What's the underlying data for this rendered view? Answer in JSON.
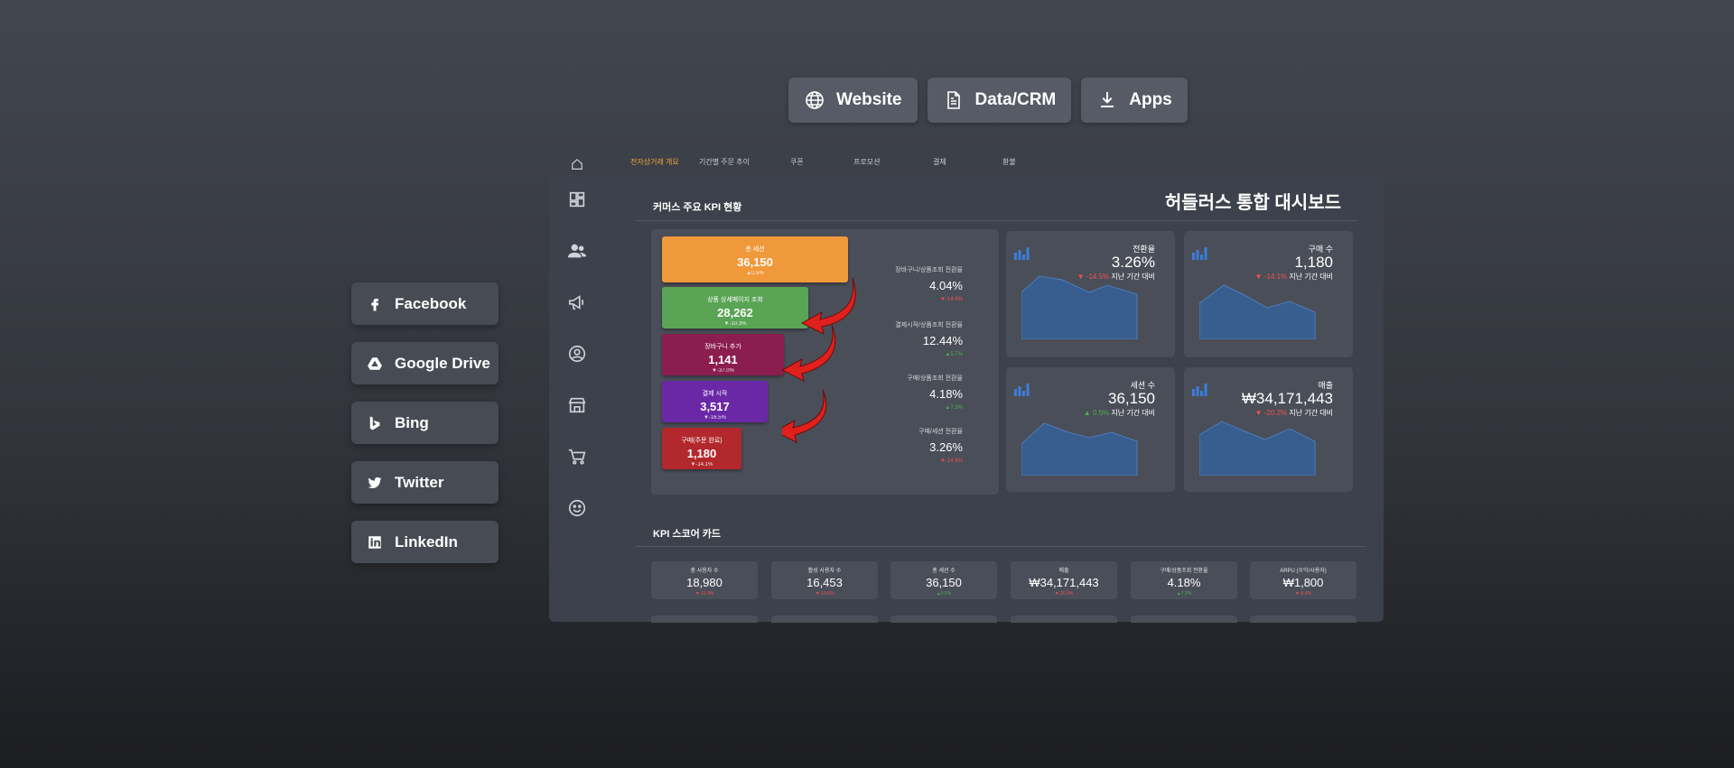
{
  "top_buttons": [
    {
      "label": "Website",
      "icon": "globe-icon"
    },
    {
      "label": "Data/CRM",
      "icon": "document-icon"
    },
    {
      "label": "Apps",
      "icon": "download-icon"
    }
  ],
  "share_buttons": [
    {
      "label": "Facebook",
      "icon": "facebook-icon"
    },
    {
      "label": "Google Drive",
      "icon": "google-drive-icon"
    },
    {
      "label": "Bing",
      "icon": "bing-icon"
    },
    {
      "label": "Twitter",
      "icon": "twitter-icon"
    },
    {
      "label": "LinkedIn",
      "icon": "linkedin-icon"
    }
  ],
  "dashboard": {
    "tabs": [
      "전자상거래 개요",
      "기간별 주문 추이",
      "쿠폰",
      "프로모션",
      "결제",
      "환불"
    ],
    "active_tab": 0,
    "title": "허들러스 통합 대시보드",
    "section_kpi": "커머스 주요 KPI 현황",
    "section_score": "KPI 스코어 카드",
    "funnel": [
      {
        "label": "총 세션",
        "value": "36,150",
        "change": "▲0.5%",
        "color": "#f0993a"
      },
      {
        "label": "상품 상세페이지 조회",
        "value": "28,262",
        "change": "▼-10.3%",
        "color": "#5aa455"
      },
      {
        "label": "장바구니 추가",
        "value": "1,141",
        "change": "▼-37.0%",
        "color": "#8b1d4f"
      },
      {
        "label": "결제 시작",
        "value": "3,517",
        "change": "▼-16.5%",
        "color": "#6a28a6"
      },
      {
        "label": "구매(주문 완료)",
        "value": "1,180",
        "change": "▼-14.1%",
        "color": "#b3282c"
      }
    ],
    "rates": [
      {
        "label": "장바구니/상품조회 전환율",
        "value": "4.04%",
        "change": "▼-14.6%",
        "dir": "neg"
      },
      {
        "label": "결제시작/상품조회 전환율",
        "value": "12.44%",
        "change": "▲5.7%",
        "dir": "pos"
      },
      {
        "label": "구매/상품조회 전환율",
        "value": "4.18%",
        "change": "▲7.3%",
        "dir": "pos"
      },
      {
        "label": "구매/세션 전환율",
        "value": "3.26%",
        "change": "▼-14.6%",
        "dir": "neg"
      }
    ],
    "kpi_cards": [
      {
        "label": "전환율",
        "value": "3.26%",
        "change": "▼ -14.5%",
        "suffix": "지난 기간 대비",
        "dir": "neg"
      },
      {
        "label": "구매 수",
        "value": "1,180",
        "change": "▼ -14.1%",
        "suffix": "지난 기간 대비",
        "dir": "neg"
      },
      {
        "label": "세션 수",
        "value": "36,150",
        "change": "▲ 0.5%",
        "suffix": "지난 기간 대비",
        "dir": "pos"
      },
      {
        "label": "매출",
        "value": "₩34,171,443",
        "change": "▼ -20.2%",
        "suffix": "지난 기간 대비",
        "dir": "neg"
      }
    ],
    "scorecards": [
      {
        "label": "총 사용자 수",
        "value": "18,980",
        "change": "▼-11.9%",
        "dir": "neg"
      },
      {
        "label": "활성 사용자 수",
        "value": "16,453",
        "change": "▼-10.6%",
        "dir": "neg"
      },
      {
        "label": "총 세션 수",
        "value": "36,150",
        "change": "▲0.5%",
        "dir": "pos"
      },
      {
        "label": "매출",
        "value": "₩34,171,443",
        "change": "▼-20.2%",
        "dir": "neg"
      },
      {
        "label": "구매/상품조회 전환율",
        "value": "4.18%",
        "change": "▲7.3%",
        "dir": "pos"
      },
      {
        "label": "ARPU (수익/사용자)",
        "value": "₩1,800",
        "change": "▼-9.4%",
        "dir": "neg"
      }
    ],
    "rail_icons": [
      "dashboard-icon",
      "users-icon",
      "megaphone-icon",
      "profile-icon",
      "store-icon",
      "cart-icon",
      "smiley-icon"
    ]
  }
}
